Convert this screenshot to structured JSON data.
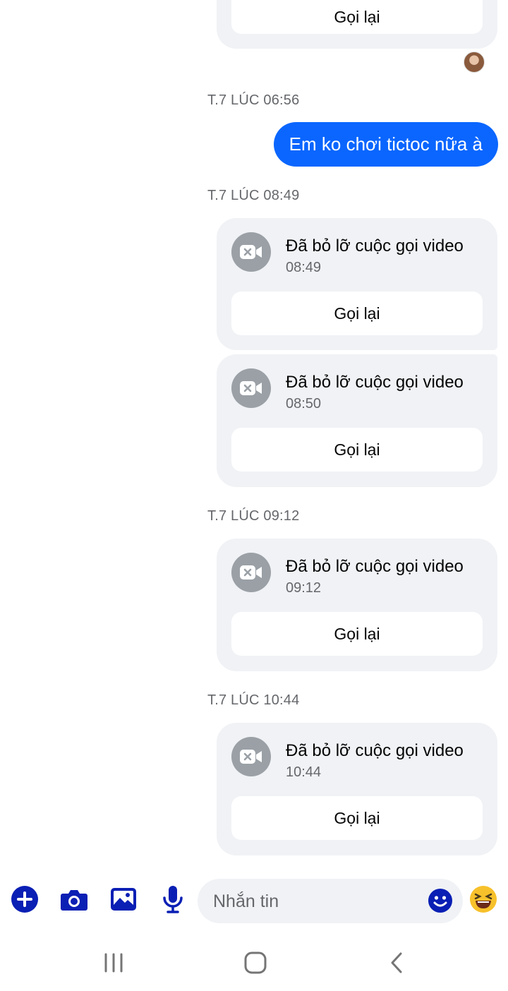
{
  "colors": {
    "accent": "#0a66ff",
    "composer_icons": "#0a1fb4",
    "bubble_bg": "#f0f2f5"
  },
  "messages": [
    {
      "type": "callback_only",
      "button": "Gọi lại"
    },
    {
      "type": "timestamp",
      "text": "T.7 LÚC 06:56"
    },
    {
      "type": "outgoing_text",
      "text": "Em ko chơi tictoc nữa à"
    },
    {
      "type": "timestamp",
      "text": "T.7 LÚC 08:49"
    },
    {
      "type": "missed_call",
      "title": "Đã bỏ lỡ cuộc gọi video",
      "time": "08:49",
      "button": "Gọi lại",
      "icon": "video-off-icon"
    },
    {
      "type": "missed_call",
      "title": "Đã bỏ lỡ cuộc gọi video",
      "time": "08:50",
      "button": "Gọi lại",
      "icon": "video-off-icon"
    },
    {
      "type": "timestamp",
      "text": "T.7 LÚC 09:12"
    },
    {
      "type": "missed_call",
      "title": "Đã bỏ lỡ cuộc gọi video",
      "time": "09:12",
      "button": "Gọi lại",
      "icon": "video-off-icon"
    },
    {
      "type": "timestamp",
      "text": "T.7 LÚC 10:44"
    },
    {
      "type": "missed_call",
      "title": "Đã bỏ lỡ cuộc gọi video",
      "time": "10:44",
      "button": "Gọi lại",
      "icon": "video-off-icon"
    }
  ],
  "composer": {
    "placeholder": "Nhắn tin",
    "icons": [
      "plus-icon",
      "camera-icon",
      "gallery-icon",
      "microphone-icon",
      "emoji-icon",
      "laughing-emoji-icon"
    ]
  },
  "navbar": {
    "icons": [
      "recents-icon",
      "home-icon",
      "back-icon"
    ]
  }
}
